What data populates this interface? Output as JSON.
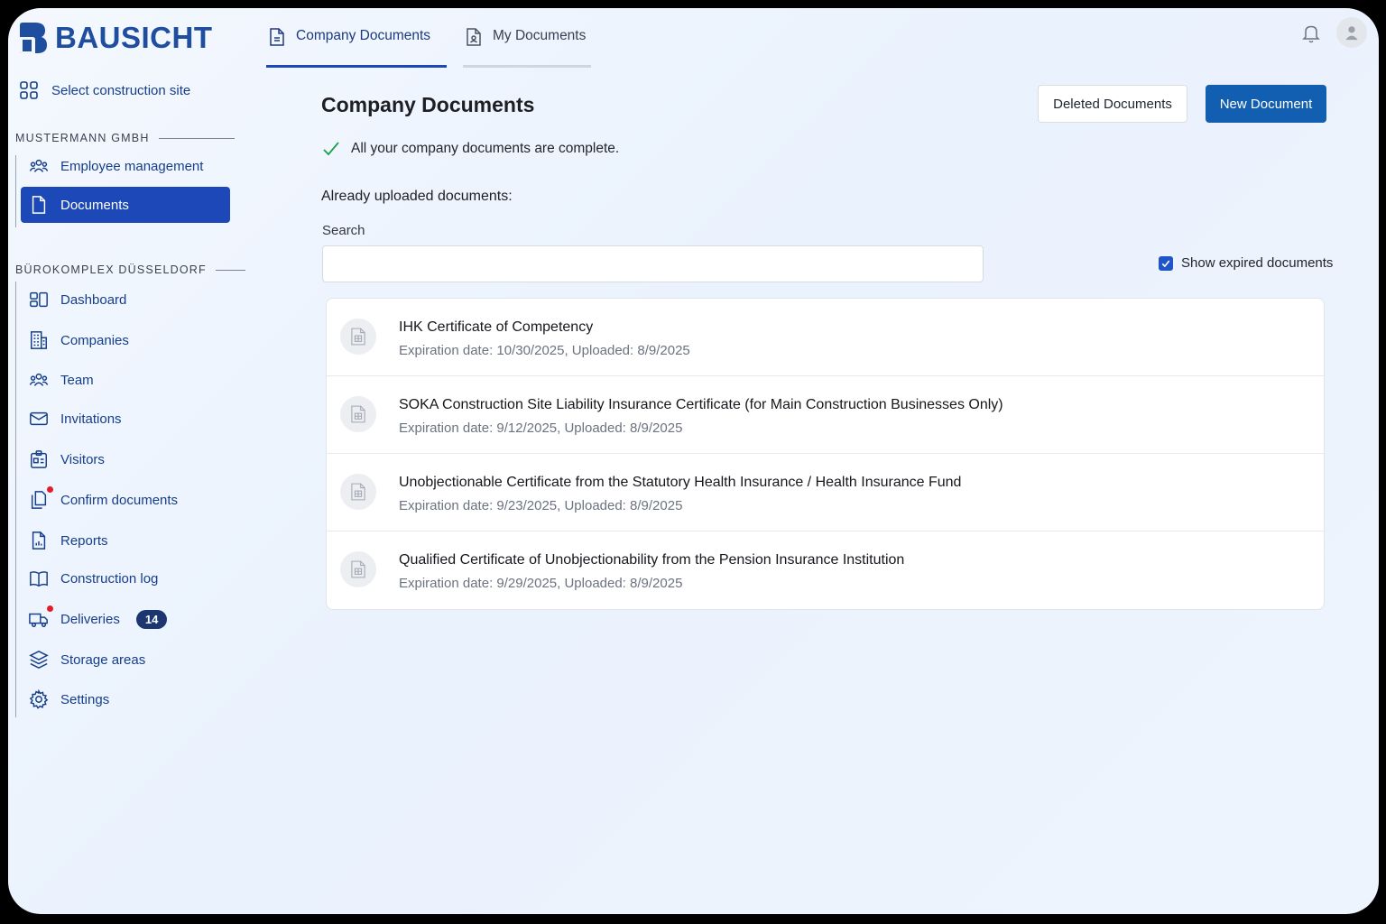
{
  "app": {
    "logo_text": "BAUSICHT"
  },
  "tabs": [
    {
      "label": "Company Documents",
      "active": true
    },
    {
      "label": "My Documents",
      "active": false
    }
  ],
  "sidebar": {
    "select_site": "Select construction site",
    "company_section": {
      "label": "MUSTERMANN GMBH",
      "items": [
        {
          "label": "Employee management",
          "icon": "people-icon"
        },
        {
          "label": "Documents",
          "icon": "document-icon",
          "active": true
        }
      ]
    },
    "site_section": {
      "label": "BÜROKOMPLEX DÜSSELDORF",
      "items": [
        {
          "label": "Dashboard",
          "icon": "dashboard-icon"
        },
        {
          "label": "Companies",
          "icon": "building-icon"
        },
        {
          "label": "Team",
          "icon": "team-icon"
        },
        {
          "label": "Invitations",
          "icon": "envelope-icon"
        },
        {
          "label": "Visitors",
          "icon": "badge-icon"
        },
        {
          "label": "Confirm documents",
          "icon": "documents-icon",
          "notification_dot": true
        },
        {
          "label": "Reports",
          "icon": "report-icon"
        },
        {
          "label": "Construction log",
          "icon": "book-icon"
        },
        {
          "label": "Deliveries",
          "icon": "truck-icon",
          "notification_dot": true,
          "badge": "14"
        },
        {
          "label": "Storage areas",
          "icon": "layers-icon"
        },
        {
          "label": "Settings",
          "icon": "gear-icon"
        }
      ]
    }
  },
  "main": {
    "title": "Company Documents",
    "deleted_button": "Deleted Documents",
    "new_button": "New Document",
    "status_message": "All your company documents are complete.",
    "uploaded_label": "Already uploaded documents:",
    "search_label": "Search",
    "search_value": "",
    "show_expired_label": "Show expired documents",
    "show_expired_checked": true,
    "documents": [
      {
        "title": "IHK Certificate of Competency",
        "meta": "Expiration date: 10/30/2025, Uploaded: 8/9/2025"
      },
      {
        "title": "SOKA Construction Site Liability Insurance Certificate (for Main Construction Businesses Only)",
        "meta": "Expiration date: 9/12/2025, Uploaded: 8/9/2025"
      },
      {
        "title": "Unobjectionable Certificate from the Statutory Health Insurance / Health Insurance Fund",
        "meta": "Expiration date: 9/23/2025, Uploaded: 8/9/2025"
      },
      {
        "title": "Qualified Certificate of Unobjectionability from the Pension Insurance Institution",
        "meta": "Expiration date: 9/29/2025, Uploaded: 8/9/2025"
      }
    ]
  },
  "colors": {
    "brand": "#1f4e9e",
    "active_nav": "#1d48b7",
    "primary_button": "#125eb0",
    "success_check": "#16a34a",
    "notification_dot": "#e11d2a"
  }
}
